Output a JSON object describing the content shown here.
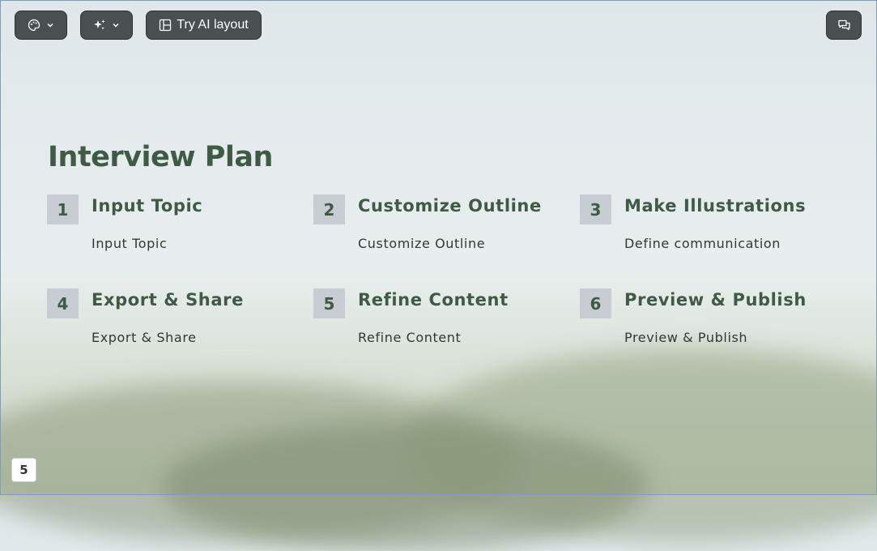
{
  "toolbar": {
    "theme_button": {
      "icon": "palette-icon",
      "dropdown": "chevron-down-icon"
    },
    "ai_button": {
      "icon": "sparkles-icon",
      "dropdown": "chevron-down-icon"
    },
    "ai_layout_button": {
      "icon": "layout-icon",
      "label": "Try AI layout"
    },
    "comment_button": {
      "icon": "comment-icon"
    }
  },
  "slide": {
    "title": "Interview Plan",
    "steps": [
      {
        "number": "1",
        "title": "Input Topic",
        "description": "Input Topic"
      },
      {
        "number": "2",
        "title": "Customize Outline",
        "description": "Customize Outline"
      },
      {
        "number": "3",
        "title": "Make Illustrations",
        "description": "Define communication"
      },
      {
        "number": "4",
        "title": "Export & Share",
        "description": "Export & Share"
      },
      {
        "number": "5",
        "title": "Refine Content",
        "description": "Refine Content"
      },
      {
        "number": "6",
        "title": "Preview & Publish",
        "description": "Preview & Publish"
      }
    ]
  },
  "page_number": "5",
  "colors": {
    "accent_green": "#3f5b45",
    "number_box": "#c7cdd3",
    "toolbar_button": "#4a4f4f"
  }
}
